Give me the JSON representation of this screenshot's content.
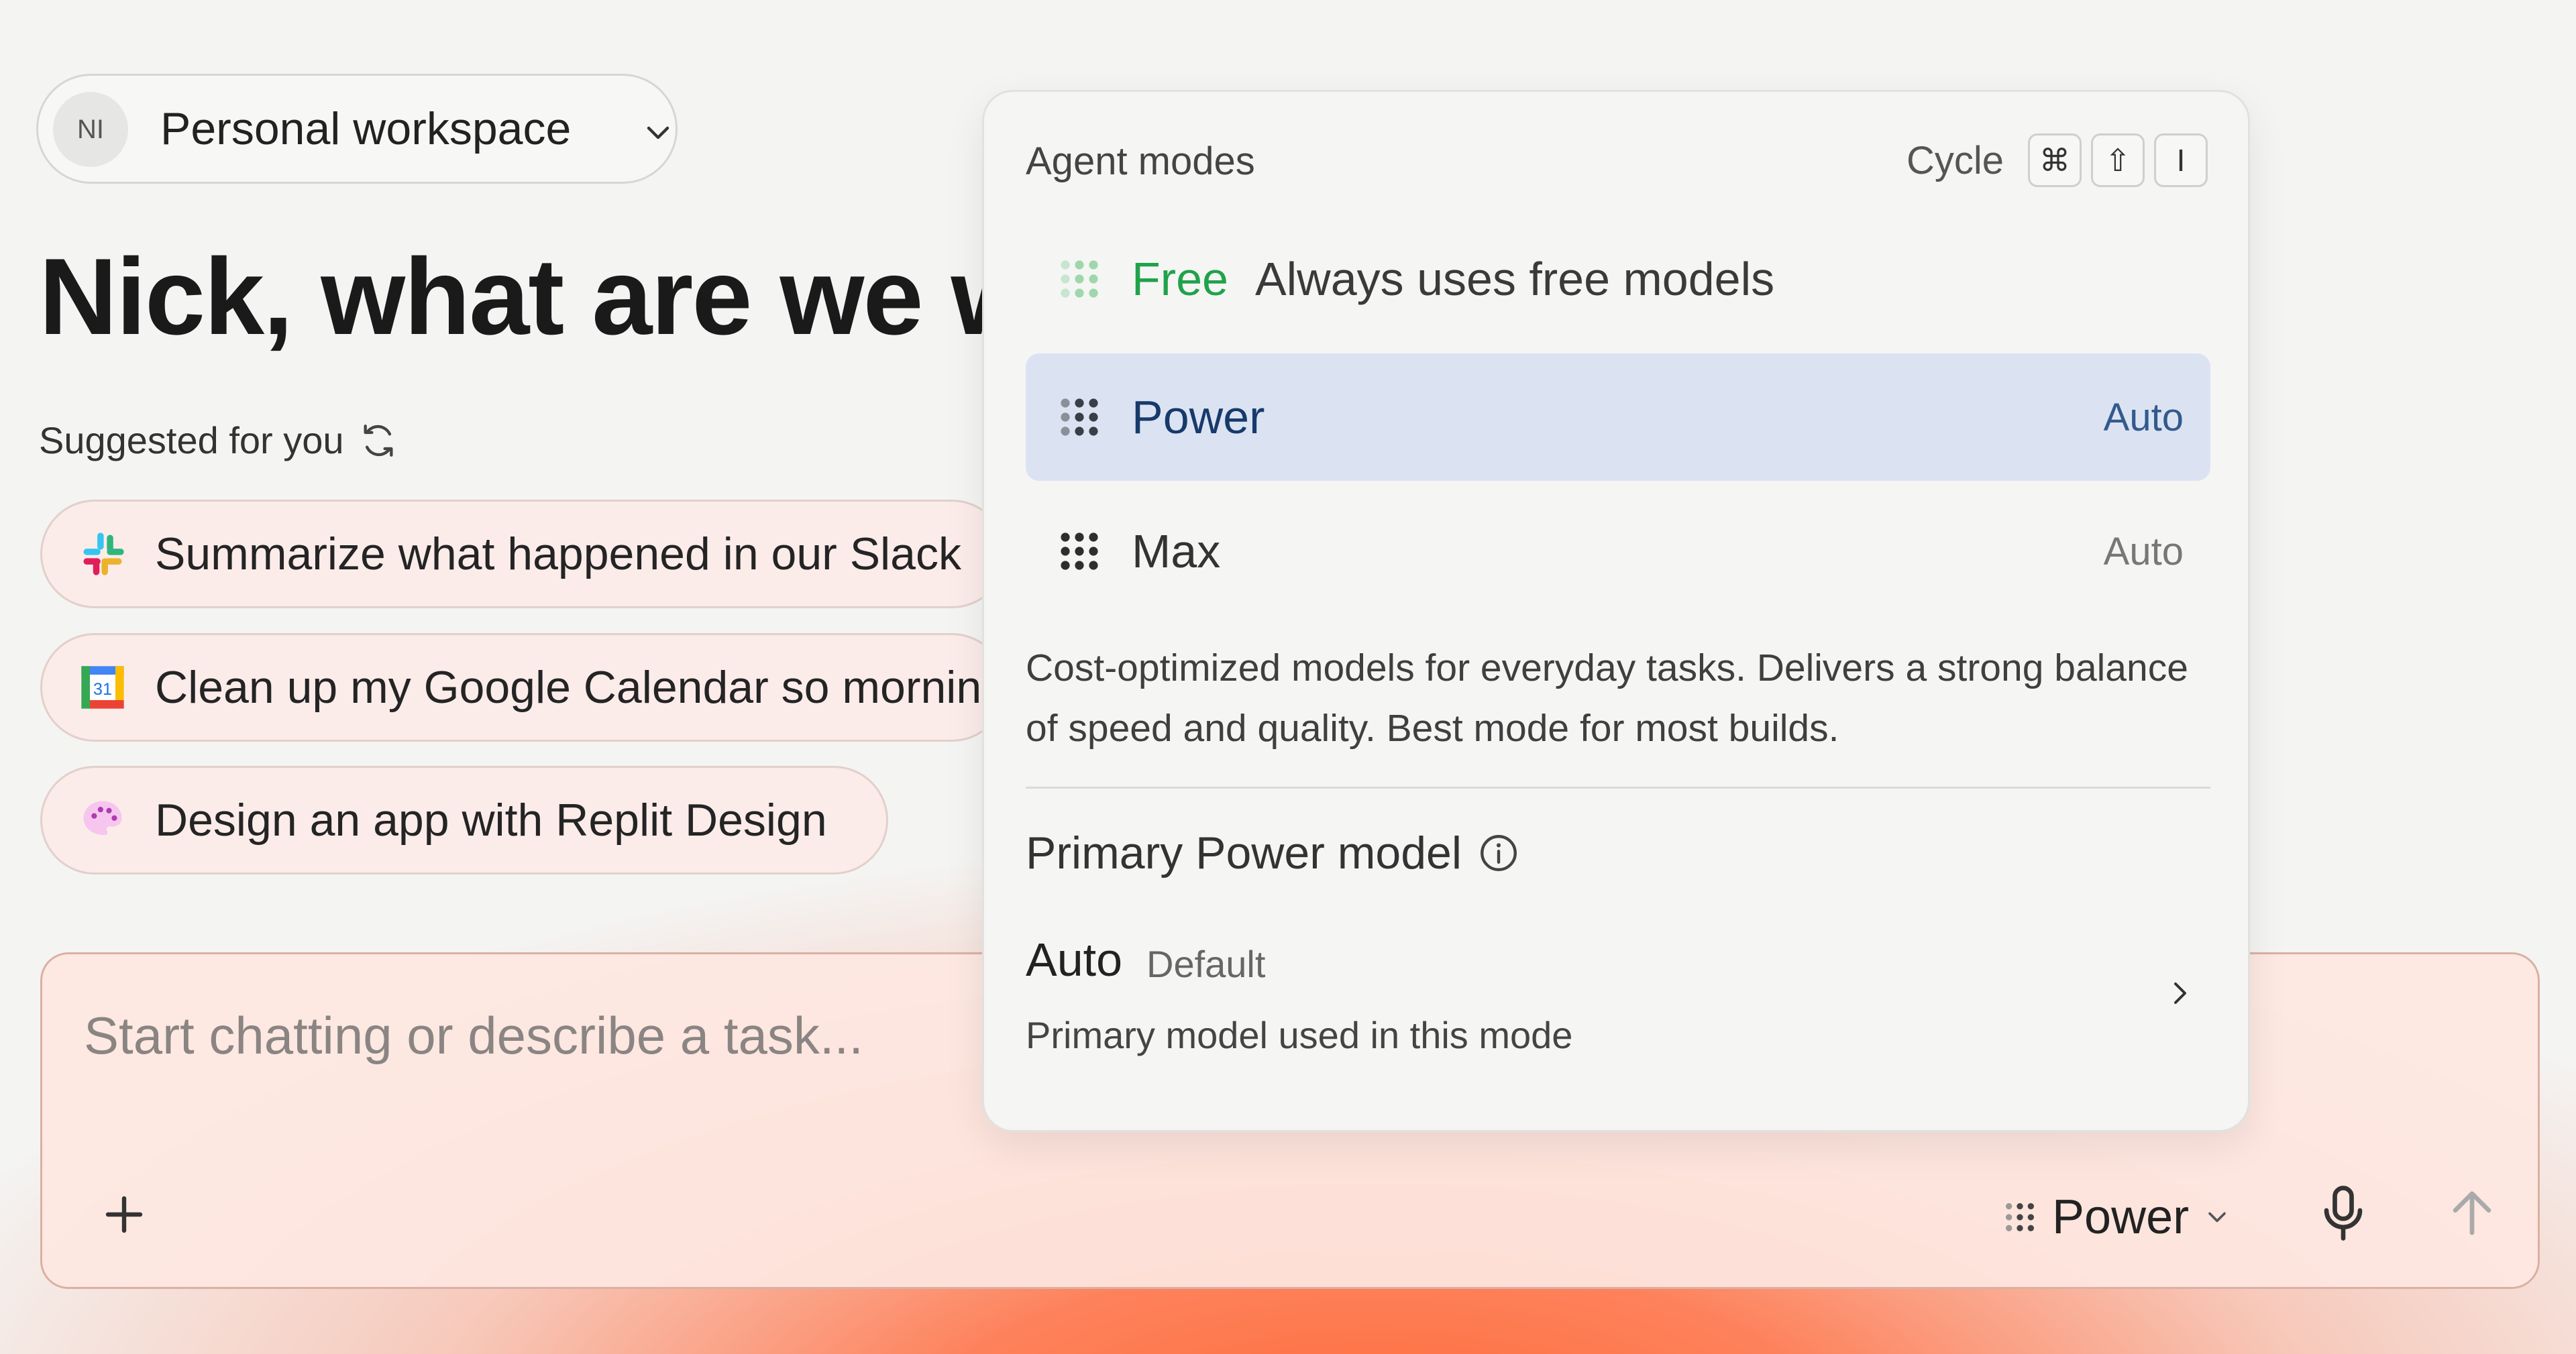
{
  "workspace": {
    "avatar_initials": "NI",
    "label": "Personal workspace"
  },
  "greeting": "Nick, what are we wo",
  "suggestions": {
    "heading": "Suggested for you",
    "items": [
      {
        "icon": "slack-icon",
        "text": "Summarize what happened in our Slack"
      },
      {
        "icon": "google-calendar-icon",
        "text": "Clean up my Google Calendar so mornin",
        "calendar_day": "31"
      },
      {
        "icon": "palette-icon",
        "text": "Design an app with Replit Design"
      }
    ]
  },
  "composer": {
    "placeholder": "Start chatting or describe a task...",
    "mode_label": "Power"
  },
  "agent_modes": {
    "title": "Agent modes",
    "cycle_label": "Cycle",
    "shortcut_keys": [
      "⌘",
      "⇧",
      "I"
    ],
    "modes": [
      {
        "name": "Free",
        "description": "Always uses free models",
        "tag": "",
        "color": "#1fa24a"
      },
      {
        "name": "Power",
        "description": "",
        "tag": "Auto",
        "selected": true
      },
      {
        "name": "Max",
        "description": "",
        "tag": "Auto"
      }
    ],
    "selected_description": "Cost-optimized models for everyday tasks. Delivers a strong balance of speed and quality. Best mode for most builds.",
    "primary_model": {
      "heading": "Primary Power model",
      "value": "Auto",
      "badge": "Default",
      "description": "Primary model used in this mode"
    }
  },
  "colors": {
    "accent_selected": "#dbe3f3",
    "free_green": "#1fa24a",
    "background_glow": "#ff6a3a"
  }
}
